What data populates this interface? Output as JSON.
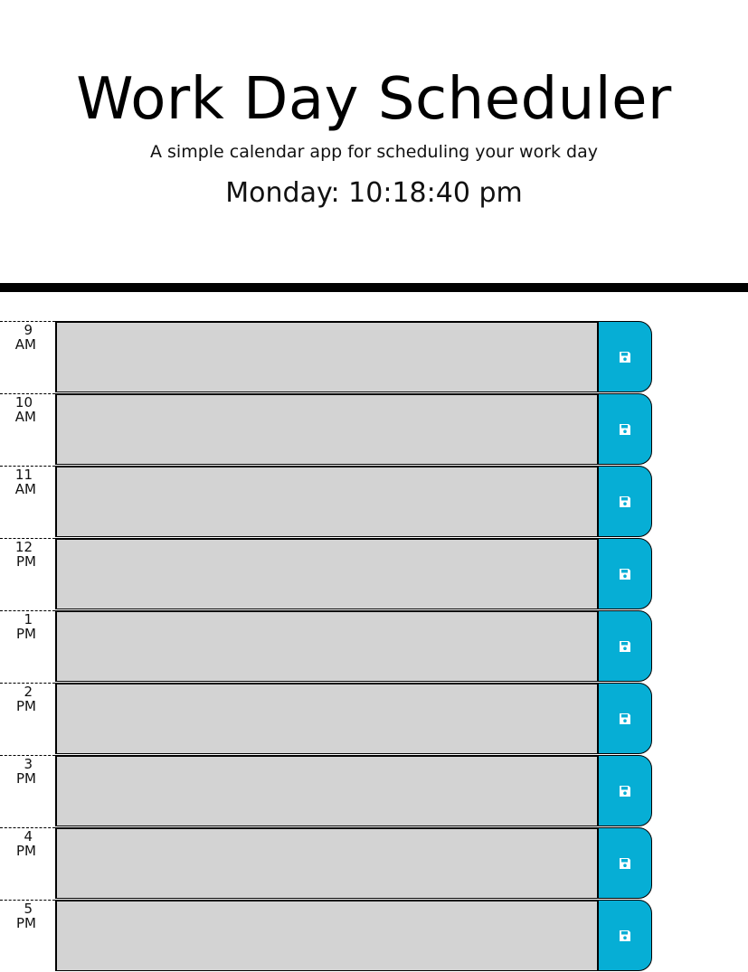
{
  "header": {
    "title": "Work Day Scheduler",
    "subtitle": "A simple calendar app for scheduling your work day",
    "current_day": "Monday: 10:18:40 pm"
  },
  "colors": {
    "past_block": "#d3d3d3",
    "save_button": "#06aed5",
    "icon": "#ffffff"
  },
  "schedule": {
    "rows": [
      {
        "hour": "9",
        "period": "AM",
        "description": "",
        "save_icon": "save-icon"
      },
      {
        "hour": "10",
        "period": "AM",
        "description": "",
        "save_icon": "save-icon"
      },
      {
        "hour": "11",
        "period": "AM",
        "description": "",
        "save_icon": "save-icon"
      },
      {
        "hour": "12",
        "period": "PM",
        "description": "",
        "save_icon": "save-icon"
      },
      {
        "hour": "1",
        "period": "PM",
        "description": "",
        "save_icon": "save-icon"
      },
      {
        "hour": "2",
        "period": "PM",
        "description": "",
        "save_icon": "save-icon"
      },
      {
        "hour": "3",
        "period": "PM",
        "description": "",
        "save_icon": "save-icon"
      },
      {
        "hour": "4",
        "period": "PM",
        "description": "",
        "save_icon": "save-icon"
      },
      {
        "hour": "5",
        "period": "PM",
        "description": "",
        "save_icon": "save-icon"
      }
    ]
  }
}
